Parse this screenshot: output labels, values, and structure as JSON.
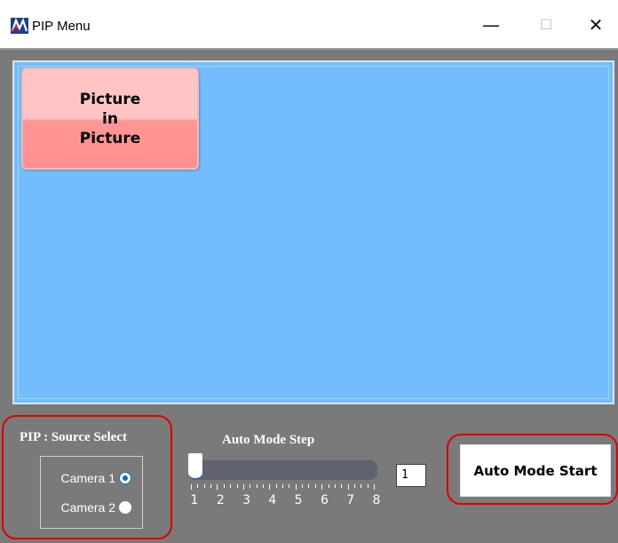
{
  "window": {
    "title": "PIP Menu",
    "minimize_glyph": "—",
    "maximize_glyph": "☐",
    "close_glyph": "✕"
  },
  "pip_button": {
    "line1": "Picture",
    "line2": "in",
    "line3": "Picture"
  },
  "source_select": {
    "label": "PIP : Source Select",
    "options": [
      {
        "label": "Camera 1",
        "checked": true
      },
      {
        "label": "Camera 2",
        "checked": false
      }
    ]
  },
  "auto_mode_step": {
    "label": "Auto Mode Step",
    "min": 1,
    "max": 8,
    "value": 1,
    "tick_labels": [
      "1",
      "2",
      "3",
      "4",
      "5",
      "6",
      "7",
      "8"
    ],
    "value_text": "1"
  },
  "auto_mode_start": {
    "label": "Auto Mode Start"
  },
  "colors": {
    "pip_area": "#73bcfd",
    "panel_bg": "#7a7a7a",
    "highlight": "#e00000",
    "pip_button_top": "#ffc4c4",
    "pip_button_bottom": "#ff8f8f"
  },
  "icons": {
    "app": "app-logo-icon"
  }
}
